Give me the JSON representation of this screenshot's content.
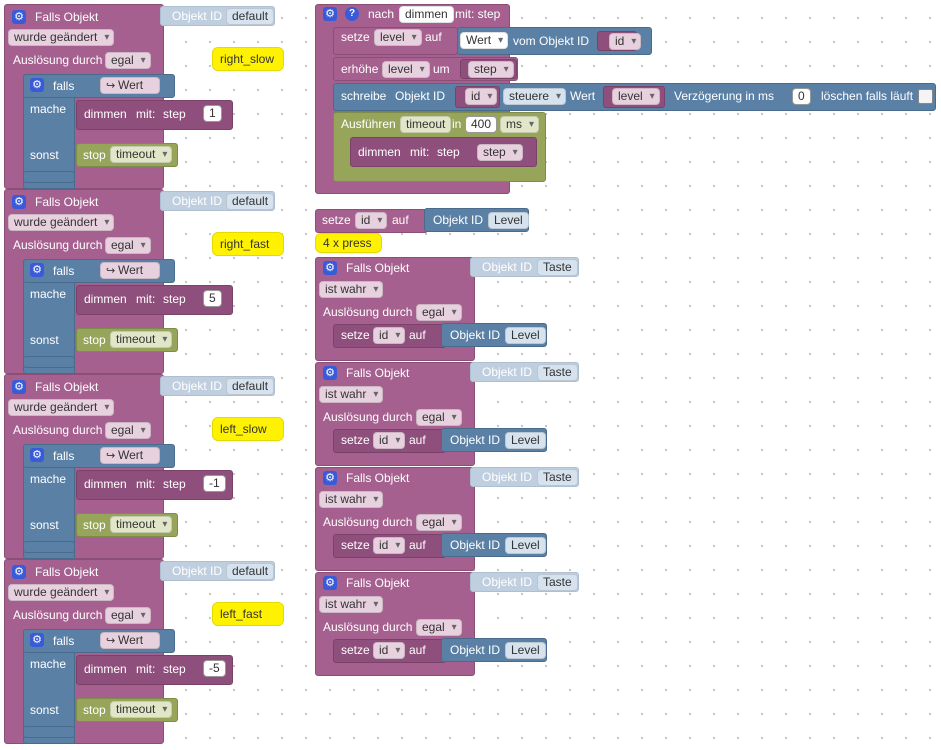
{
  "left_groups": [
    {
      "falls": "Falls Objekt",
      "objekt_id": "Objekt ID",
      "default": "default",
      "trigger": "wurde geändert",
      "ausloesung": "Auslösung durch",
      "egal": "egal",
      "falls_kw": "falls",
      "wert": "Wert",
      "mache": "mache",
      "dimmen": "dimmen",
      "mit": "mit:",
      "step": "step",
      "step_val": "1",
      "sonst": "sonst",
      "stop": "stop",
      "timeout": "timeout",
      "comment": "right_slow"
    },
    {
      "falls": "Falls Objekt",
      "objekt_id": "Objekt ID",
      "default": "default",
      "trigger": "wurde geändert",
      "ausloesung": "Auslösung durch",
      "egal": "egal",
      "falls_kw": "falls",
      "wert": "Wert",
      "mache": "mache",
      "dimmen": "dimmen",
      "mit": "mit:",
      "step": "step",
      "step_val": "5",
      "sonst": "sonst",
      "stop": "stop",
      "timeout": "timeout",
      "comment": "right_fast"
    },
    {
      "falls": "Falls Objekt",
      "objekt_id": "Objekt ID",
      "default": "default",
      "trigger": "wurde geändert",
      "ausloesung": "Auslösung durch",
      "egal": "egal",
      "falls_kw": "falls",
      "wert": "Wert",
      "mache": "mache",
      "dimmen": "dimmen",
      "mit": "mit:",
      "step": "step",
      "step_val": "-1",
      "sonst": "sonst",
      "stop": "stop",
      "timeout": "timeout",
      "comment": "left_slow"
    },
    {
      "falls": "Falls Objekt",
      "objekt_id": "Objekt ID",
      "default": "default",
      "trigger": "wurde geändert",
      "ausloesung": "Auslösung durch",
      "egal": "egal",
      "falls_kw": "falls",
      "wert": "Wert",
      "mache": "mache",
      "dimmen": "dimmen",
      "mit": "mit:",
      "step": "step",
      "step_val": "-5",
      "sonst": "sonst",
      "stop": "stop",
      "timeout": "timeout",
      "comment": "left_fast"
    }
  ],
  "func": {
    "nach": "nach",
    "name": "dimmen",
    "mit": "mit: step",
    "setze": "setze",
    "level": "level",
    "auf": "auf",
    "wert": "Wert",
    "vom": "vom Objekt ID",
    "id": "id",
    "erhoehe": "erhöhe",
    "um": "um",
    "step": "step",
    "schreibe": "schreibe",
    "objekt_id": "Objekt ID",
    "steuere": "steuere",
    "wert_kw": "Wert",
    "verz": "Verzögerung in ms",
    "delay": "0",
    "loeschen": "löschen falls läuft",
    "ausfuehren": "Ausführen",
    "timeout": "timeout",
    "in": "in",
    "ms_val": "400",
    "ms": "ms",
    "dimmen": "dimmen",
    "mit2": "mit:"
  },
  "setze_id": {
    "setze": "setze",
    "id": "id",
    "auf": "auf",
    "objekt_id": "Objekt ID",
    "level": "Level"
  },
  "press_comment": "4 x press",
  "right_groups": [
    {
      "falls": "Falls Objekt",
      "objekt_id": "Objekt ID",
      "taste": "Taste",
      "ist_wahr": "ist wahr",
      "ausloesung": "Auslösung durch",
      "egal": "egal",
      "setze": "setze",
      "id": "id",
      "auf": "auf",
      "oid": "Objekt ID",
      "level": "Level"
    },
    {
      "falls": "Falls Objekt",
      "objekt_id": "Objekt ID",
      "taste": "Taste",
      "ist_wahr": "ist wahr",
      "ausloesung": "Auslösung durch",
      "egal": "egal",
      "setze": "setze",
      "id": "id",
      "auf": "auf",
      "oid": "Objekt ID",
      "level": "Level"
    },
    {
      "falls": "Falls Objekt",
      "objekt_id": "Objekt ID",
      "taste": "Taste",
      "ist_wahr": "ist wahr",
      "ausloesung": "Auslösung durch",
      "egal": "egal",
      "setze": "setze",
      "id": "id",
      "auf": "auf",
      "oid": "Objekt ID",
      "level": "Level"
    },
    {
      "falls": "Falls Objekt",
      "objekt_id": "Objekt ID",
      "taste": "Taste",
      "ist_wahr": "ist wahr",
      "ausloesung": "Auslösung durch",
      "egal": "egal",
      "setze": "setze",
      "id": "id",
      "auf": "auf",
      "oid": "Objekt ID",
      "level": "Level"
    }
  ],
  "icons": {
    "gear": "gear-icon",
    "help": "help-icon",
    "arrow": "return-arrow-icon"
  },
  "colors": {
    "event": "#a5608f",
    "logic": "#5b80a5",
    "timer": "#97a55b",
    "comment": "#fff200",
    "id_field": "#bfcfe0"
  }
}
